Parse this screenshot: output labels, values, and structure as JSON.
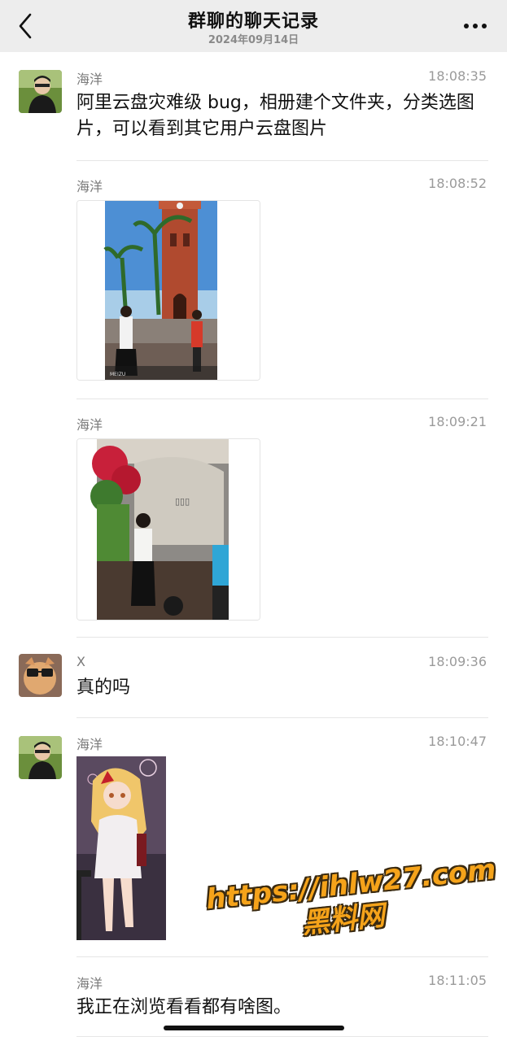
{
  "header": {
    "title": "群聊的聊天记录",
    "date": "2024年09月14日"
  },
  "messages": [
    {
      "sender": "海洋",
      "time": "18:08:35",
      "text": "阿里云盘灾难级 bug，相册建个文件夹，分类选图片，可以看到其它用户云盘图片"
    },
    {
      "sender": "海洋",
      "time": "18:08:52",
      "image_caption": "MEIZU"
    },
    {
      "sender": "海洋",
      "time": "18:09:21"
    },
    {
      "sender": "X",
      "time": "18:09:36",
      "text": "真的吗"
    },
    {
      "sender": "海洋",
      "time": "18:10:47"
    },
    {
      "sender": "海洋",
      "time": "18:11:05",
      "text": "我正在浏览看看都有啥图。"
    }
  ],
  "watermark": {
    "url": "https://ihlw27.com",
    "name": "黑料网"
  },
  "colors": {
    "header_bg": "#ededed",
    "watermark": "#f5a31a"
  }
}
